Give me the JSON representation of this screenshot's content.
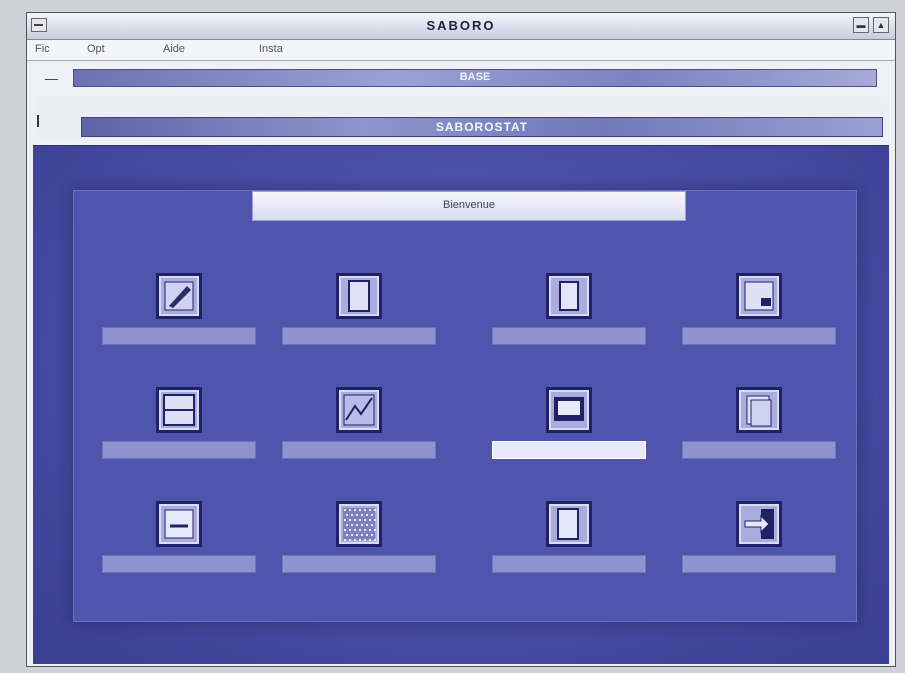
{
  "window": {
    "title": "SABORO",
    "min_glyph": "▬",
    "max_glyph": "▲"
  },
  "menu": {
    "items": [
      "Fic",
      "Opt",
      "Aide",
      "Insta"
    ]
  },
  "doc_bar1": {
    "minus_glyph": "—",
    "title": "BASE"
  },
  "doc_bar2": {
    "title": "SABOROSTAT"
  },
  "dialog": {
    "title": "Bienvenue",
    "subtitle": ""
  },
  "tiles": [
    {
      "icon": "pencil-edit-icon",
      "label": "",
      "selected": false
    },
    {
      "icon": "document-icon",
      "label": "",
      "selected": false
    },
    {
      "icon": "page-icon",
      "label": "",
      "selected": false
    },
    {
      "icon": "document-corner-icon",
      "label": "",
      "selected": false
    },
    {
      "icon": "table-grid-icon",
      "label": "",
      "selected": false
    },
    {
      "icon": "chart-icon",
      "label": "",
      "selected": false
    },
    {
      "icon": "monitor-icon",
      "label": "",
      "selected": true
    },
    {
      "icon": "stacked-pages-icon",
      "label": "",
      "selected": false
    },
    {
      "icon": "text-lines-icon",
      "label": "",
      "selected": false
    },
    {
      "icon": "pattern-grid-icon",
      "label": "",
      "selected": false
    },
    {
      "icon": "copy-pages-icon",
      "label": "",
      "selected": false
    },
    {
      "icon": "exit-arrow-icon",
      "label": "",
      "selected": false
    }
  ],
  "colors": {
    "workspace": "#4a4fa6",
    "dialog": "#4f54ad",
    "icon_border": "#1f2266",
    "selected_label": "#e8e9fb"
  }
}
